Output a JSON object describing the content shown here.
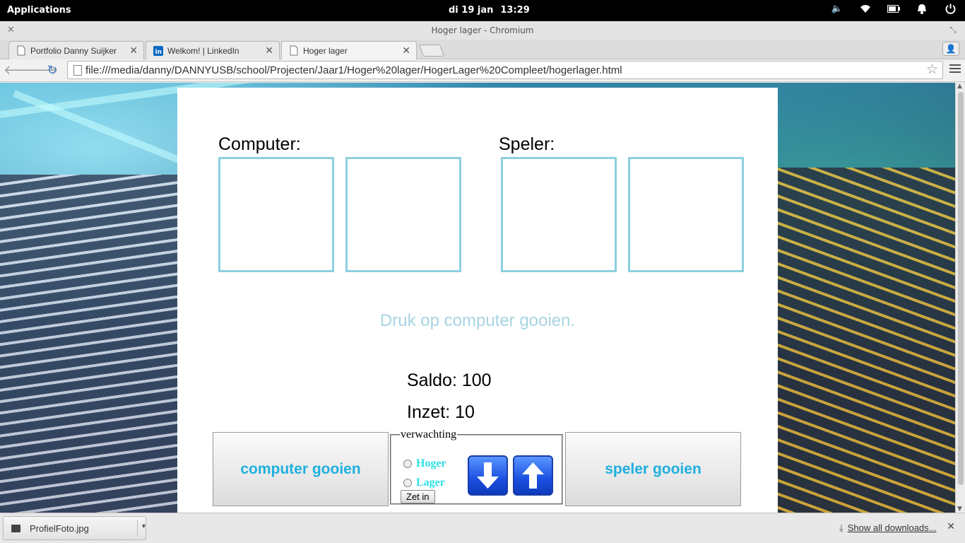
{
  "system": {
    "apps_label": "Applications",
    "date": "di 19 jan",
    "time": "13:29"
  },
  "window": {
    "title": "Hoger lager - Chromium"
  },
  "tabs": [
    {
      "label": "Portfolio Danny Suijker",
      "icon": "page-icon"
    },
    {
      "label": "Welkom! | LinkedIn",
      "icon": "linkedin-icon"
    },
    {
      "label": "Hoger lager",
      "icon": "page-icon",
      "active": true
    }
  ],
  "address": {
    "url": "file:///media/danny/DANNYUSB/school/Projecten/Jaar1/Hoger%20lager/HogerLager%20Compleet/hogerlager.html"
  },
  "game": {
    "computer_label": "Computer:",
    "player_label": "Speler:",
    "message": "Druk op computer gooien.",
    "saldo": "Saldo: 100",
    "inzet": "Inzet: 10",
    "computer_button": "computer gooien",
    "player_button": "speler gooien",
    "fieldset_legend": "verwachting",
    "option_higher": "Hoger",
    "option_lower": "Lager",
    "bet_button": "Zet in"
  },
  "downloads": {
    "file": "ProfielFoto.jpg",
    "show_all": "Show all downloads..."
  },
  "colors": {
    "accent": "#1fb0de",
    "card_border": "#8ecfe0",
    "message": "#a7d4e3",
    "radio_label": "#2de0e6"
  }
}
